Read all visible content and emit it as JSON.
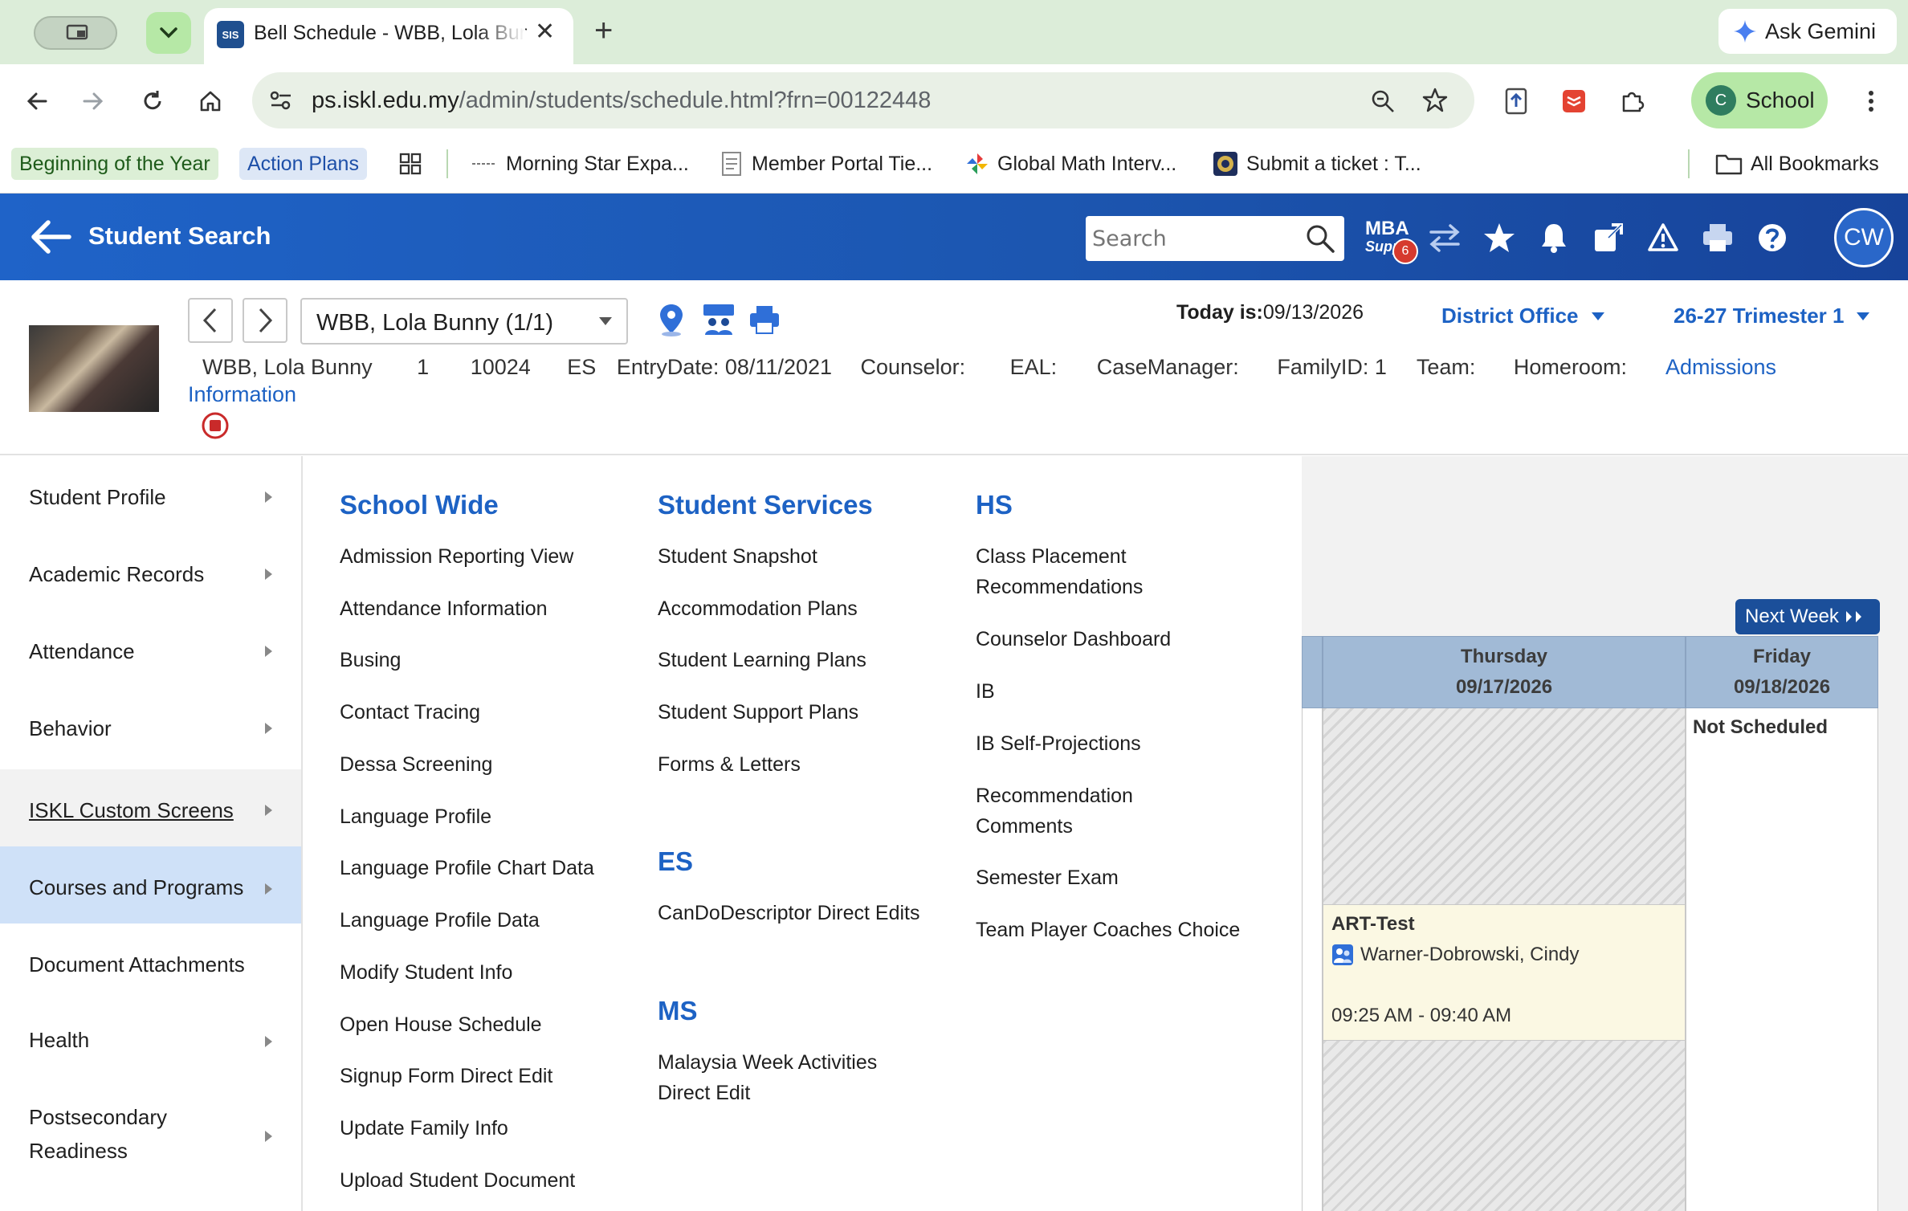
{
  "browser": {
    "tab_title": "Bell Schedule - WBB, Lola Bunny",
    "favicon_text": "SIS",
    "new_tab": "+",
    "gemini_label": "Ask Gemini",
    "url_host": "ps.iskl.edu.my",
    "url_path": "/admin/students/schedule.html?frn=00122448",
    "profile_initial": "C",
    "profile_label": "School",
    "bookmarks": [
      {
        "label": "Beginning of the Year"
      },
      {
        "label": "Action Plans"
      },
      {
        "label": "Morning Star Expa..."
      },
      {
        "label": "Member Portal Tie..."
      },
      {
        "label": "Global Math Interv..."
      },
      {
        "label": "Submit a ticket : T..."
      }
    ],
    "all_bookmarks": "All Bookmarks"
  },
  "ps_header": {
    "back_label": "Student Search",
    "search_placeholder": "Search",
    "mba_line1": "MBA",
    "mba_line2": "Supp",
    "mba_badge": "6",
    "user_initials": "CW"
  },
  "student": {
    "selector_value": "WBB, Lola Bunny  (1/1)",
    "today_label": "Today is:",
    "today_date": "09/13/2026",
    "school_dd": "District Office",
    "term_dd": "26-27 Trimester 1",
    "info": {
      "name": "WBB, Lola Bunny",
      "grade": "1",
      "id": "10024",
      "school": "ES",
      "entry": "EntryDate: 08/11/2021",
      "counselor": "Counselor:",
      "eal": "EAL:",
      "case_manager": "CaseManager:",
      "family": "FamilyID: 1",
      "team": "Team:",
      "homeroom": "Homeroom:",
      "admissions": "Admissions",
      "information": "Information"
    }
  },
  "sidebar": {
    "items": [
      {
        "label": "Student Profile"
      },
      {
        "label": "Academic Records"
      },
      {
        "label": "Attendance"
      },
      {
        "label": "Behavior"
      },
      {
        "label": "ISKL Custom Screens"
      },
      {
        "label": "Courses and Programs"
      },
      {
        "label": "Document Attachments"
      },
      {
        "label": "Health"
      },
      {
        "label": "Postsecondary"
      },
      {
        "label": "Readiness"
      }
    ]
  },
  "menu": {
    "school_wide": {
      "title": "School Wide",
      "items": [
        "Admission Reporting View",
        "Attendance Information",
        "Busing",
        "Contact Tracing",
        "Dessa Screening",
        "Language Profile",
        "Language Profile Chart Data",
        "Language Profile Data",
        "Modify Student Info",
        "Open House Schedule",
        "Signup Form Direct Edit",
        "Update Family Info",
        "Upload Student Document"
      ]
    },
    "student_services": {
      "title": "Student Services",
      "items": [
        "Student Snapshot",
        "Accommodation Plans",
        "Student Learning Plans",
        "Student Support Plans",
        "Forms & Letters"
      ]
    },
    "es": {
      "title": "ES",
      "items": [
        "CanDoDescriptor Direct Edits"
      ]
    },
    "ms": {
      "title": "MS",
      "items": [
        "Malaysia Week Activities",
        "Direct Edit"
      ]
    },
    "hs": {
      "title": "HS",
      "items": [
        "Class Placement",
        "Recommendations",
        "Counselor Dashboard",
        "IB",
        "IB Self-Projections",
        "Recommendation",
        "Comments",
        "Semester Exam",
        "Team Player Coaches Choice"
      ]
    }
  },
  "calendar": {
    "next_week": "Next Week",
    "days": [
      {
        "name": "Thursday",
        "date": "09/17/2026"
      },
      {
        "name": "Friday",
        "date": "09/18/2026"
      }
    ],
    "appt": {
      "title": "ART-Test",
      "teacher": "Warner-Dobrowski, Cindy",
      "time": "09:25 AM - 09:40 AM"
    },
    "not_scheduled": "Not Scheduled"
  },
  "colors": {
    "ps_blue": "#1f63c8",
    "link_blue": "#1d62c4",
    "chrome_green": "#dcedd9"
  }
}
